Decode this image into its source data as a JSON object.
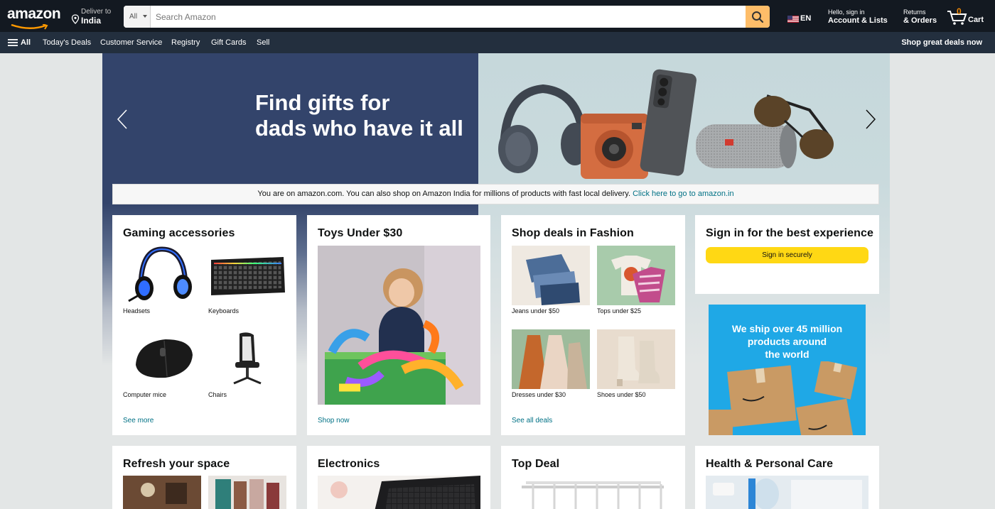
{
  "header": {
    "logo_text": "amazon",
    "deliver_to_label": "Deliver to",
    "deliver_to_location": "India",
    "search_category": "All",
    "search_placeholder": "Search Amazon",
    "language": "EN",
    "account_greeting": "Hello, sign in",
    "account_label": "Account & Lists",
    "returns_label": "Returns",
    "orders_label": "& Orders",
    "cart_count": "0",
    "cart_label": "Cart"
  },
  "subnav": {
    "all_label": "All",
    "items": [
      "Today's Deals",
      "Customer Service",
      "Registry",
      "Gift Cards",
      "Sell"
    ],
    "promo": "Shop great deals now"
  },
  "hero": {
    "headline_line1": "Find gifts for",
    "headline_line2": "dads who have it all"
  },
  "notice": {
    "text": "You are on amazon.com. You can also shop on Amazon India for millions of products with fast local delivery. ",
    "link": "Click here to go to amazon.in"
  },
  "cards": {
    "gaming": {
      "title": "Gaming accessories",
      "tiles": [
        "Headsets",
        "Keyboards",
        "Computer mice",
        "Chairs"
      ],
      "link": "See more"
    },
    "toys": {
      "title": "Toys Under $30",
      "link": "Shop now"
    },
    "fashion": {
      "title": "Shop deals in Fashion",
      "tiles": [
        "Jeans under $50",
        "Tops under $25",
        "Dresses under $30",
        "Shoes under $50"
      ],
      "link": "See all deals"
    },
    "signin": {
      "title": "Sign in for the best experience",
      "button": "Sign in securely"
    },
    "ship_ad": {
      "line1": "We ship over 45 million",
      "line2": "products around",
      "line3": "the world"
    },
    "refresh": {
      "title": "Refresh your space"
    },
    "electronics": {
      "title": "Electronics"
    },
    "top_deal": {
      "title": "Top Deal"
    },
    "health": {
      "title": "Health & Personal Care"
    }
  },
  "colors": {
    "nav_dark": "#131921",
    "nav_sub": "#232f3e",
    "search_button": "#febd69",
    "sign_in_button": "#ffd814",
    "link": "#007185",
    "hero_left": "#33446b"
  }
}
